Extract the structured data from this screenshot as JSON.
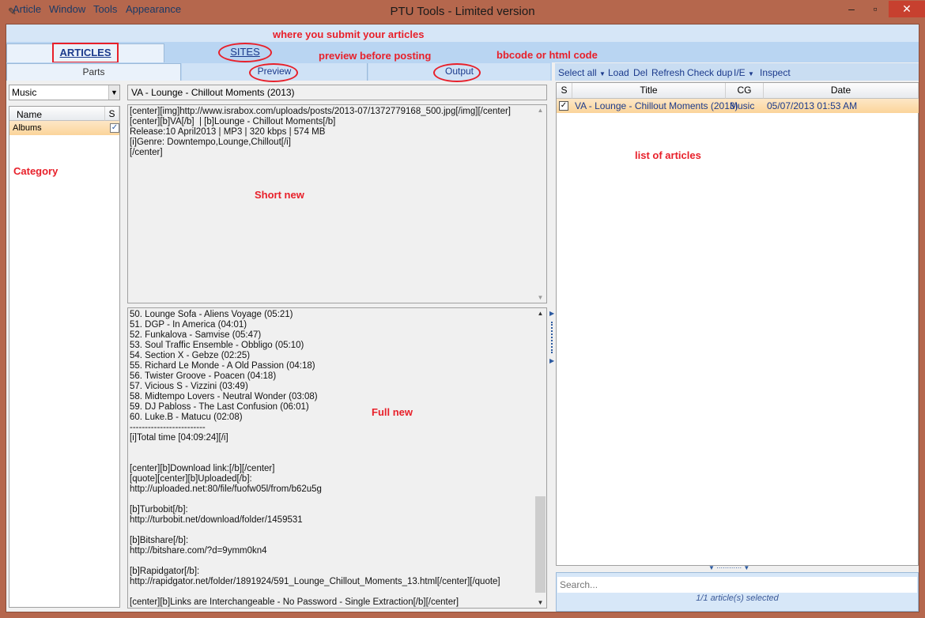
{
  "window": {
    "title": "PTU Tools - Limited version",
    "minimize": "–",
    "restore": "▫",
    "close": "✕"
  },
  "menu": [
    "Article",
    "Window",
    "Tools",
    "Appearance"
  ],
  "tabs": {
    "articles": "ARTICLES",
    "sites": "SITES"
  },
  "subtabs": {
    "parts": "Parts",
    "preview": "Preview",
    "output": "Output"
  },
  "category": {
    "selected": "Music",
    "columns": {
      "name": "Name",
      "s": "S"
    },
    "rows": [
      {
        "name": "Albums",
        "checked": true
      }
    ]
  },
  "article": {
    "title": "VA - Lounge - Chillout Moments (2013)",
    "short_new": "[center][img]http://www.israbox.com/uploads/posts/2013-07/1372779168_500.jpg[/img][/center]\n[center][b]VA[/b]  | [b]Lounge - Chillout Moments[/b]\nRelease:10 April2013 | MP3 | 320 kbps | 574 MB\n[i]Genre: Downtempo,Lounge,Chillout[/i]\n[/center]",
    "full_new": "50. Lounge Sofa - Aliens Voyage (05:21)\n51. DGP - In America (04:01)\n52. Funkalova - Samvise (05:47)\n53. Soul Traffic Ensemble - Obbligo (05:10)\n54. Section X - Gebze (02:25)\n55. Richard Le Monde - A Old Passion (04:18)\n56. Twister Groove - Poacen (04:18)\n57. Vicious S - Vizzini (03:49)\n58. Midtempo Lovers - Neutral Wonder (03:08)\n59. DJ Pabloss - The Last Confusion (06:01)\n60. Luke.B - Matucu (02:08)\n-------------------------\n[i]Total time [04:09:24][/i]\n\n\n[center][b]Download link:[/b][/center]\n[quote][center][b]Uploaded[/b]:\nhttp://uploaded.net:80/file/fuofw05l/from/b62u5g\n\n[b]Turbobit[/b]:\nhttp://turbobit.net/download/folder/1459531\n\n[b]Bitshare[/b]:\nhttp://bitshare.com/?d=9ymm0kn4\n\n[b]Rapidgator[/b]:\nhttp://rapidgator.net/folder/1891924/591_Lounge_Chillout_Moments_13.html[/center][/quote]\n\n[center][b]Links are Interchangeable - No Password - Single Extraction[/b][/center]"
  },
  "toolbar": [
    "Select all",
    "Load",
    "Del",
    "Refresh",
    "Check dup",
    "I/E",
    "Inspect"
  ],
  "articles_list": {
    "columns": {
      "s": "S",
      "title": "Title",
      "cg": "CG",
      "date": "Date"
    },
    "rows": [
      {
        "checked": true,
        "title": "VA - Lounge - Chillout Moments (2013)",
        "cg": "Music",
        "date": "05/07/2013 01:53 AM"
      }
    ]
  },
  "search": {
    "placeholder": "Search..."
  },
  "status": "1/1 article(s) selected",
  "annotations": {
    "submit": "where you submit your articles",
    "preview": "preview before posting",
    "output": "bbcode or html code",
    "category": "Category",
    "short": "Short new",
    "full": "Full new",
    "list": "list of articles"
  },
  "colors": {
    "frame": "#b5674d",
    "accent": "#1b3a8c",
    "annotation": "#e8202a",
    "selection": "#fbd49a"
  }
}
